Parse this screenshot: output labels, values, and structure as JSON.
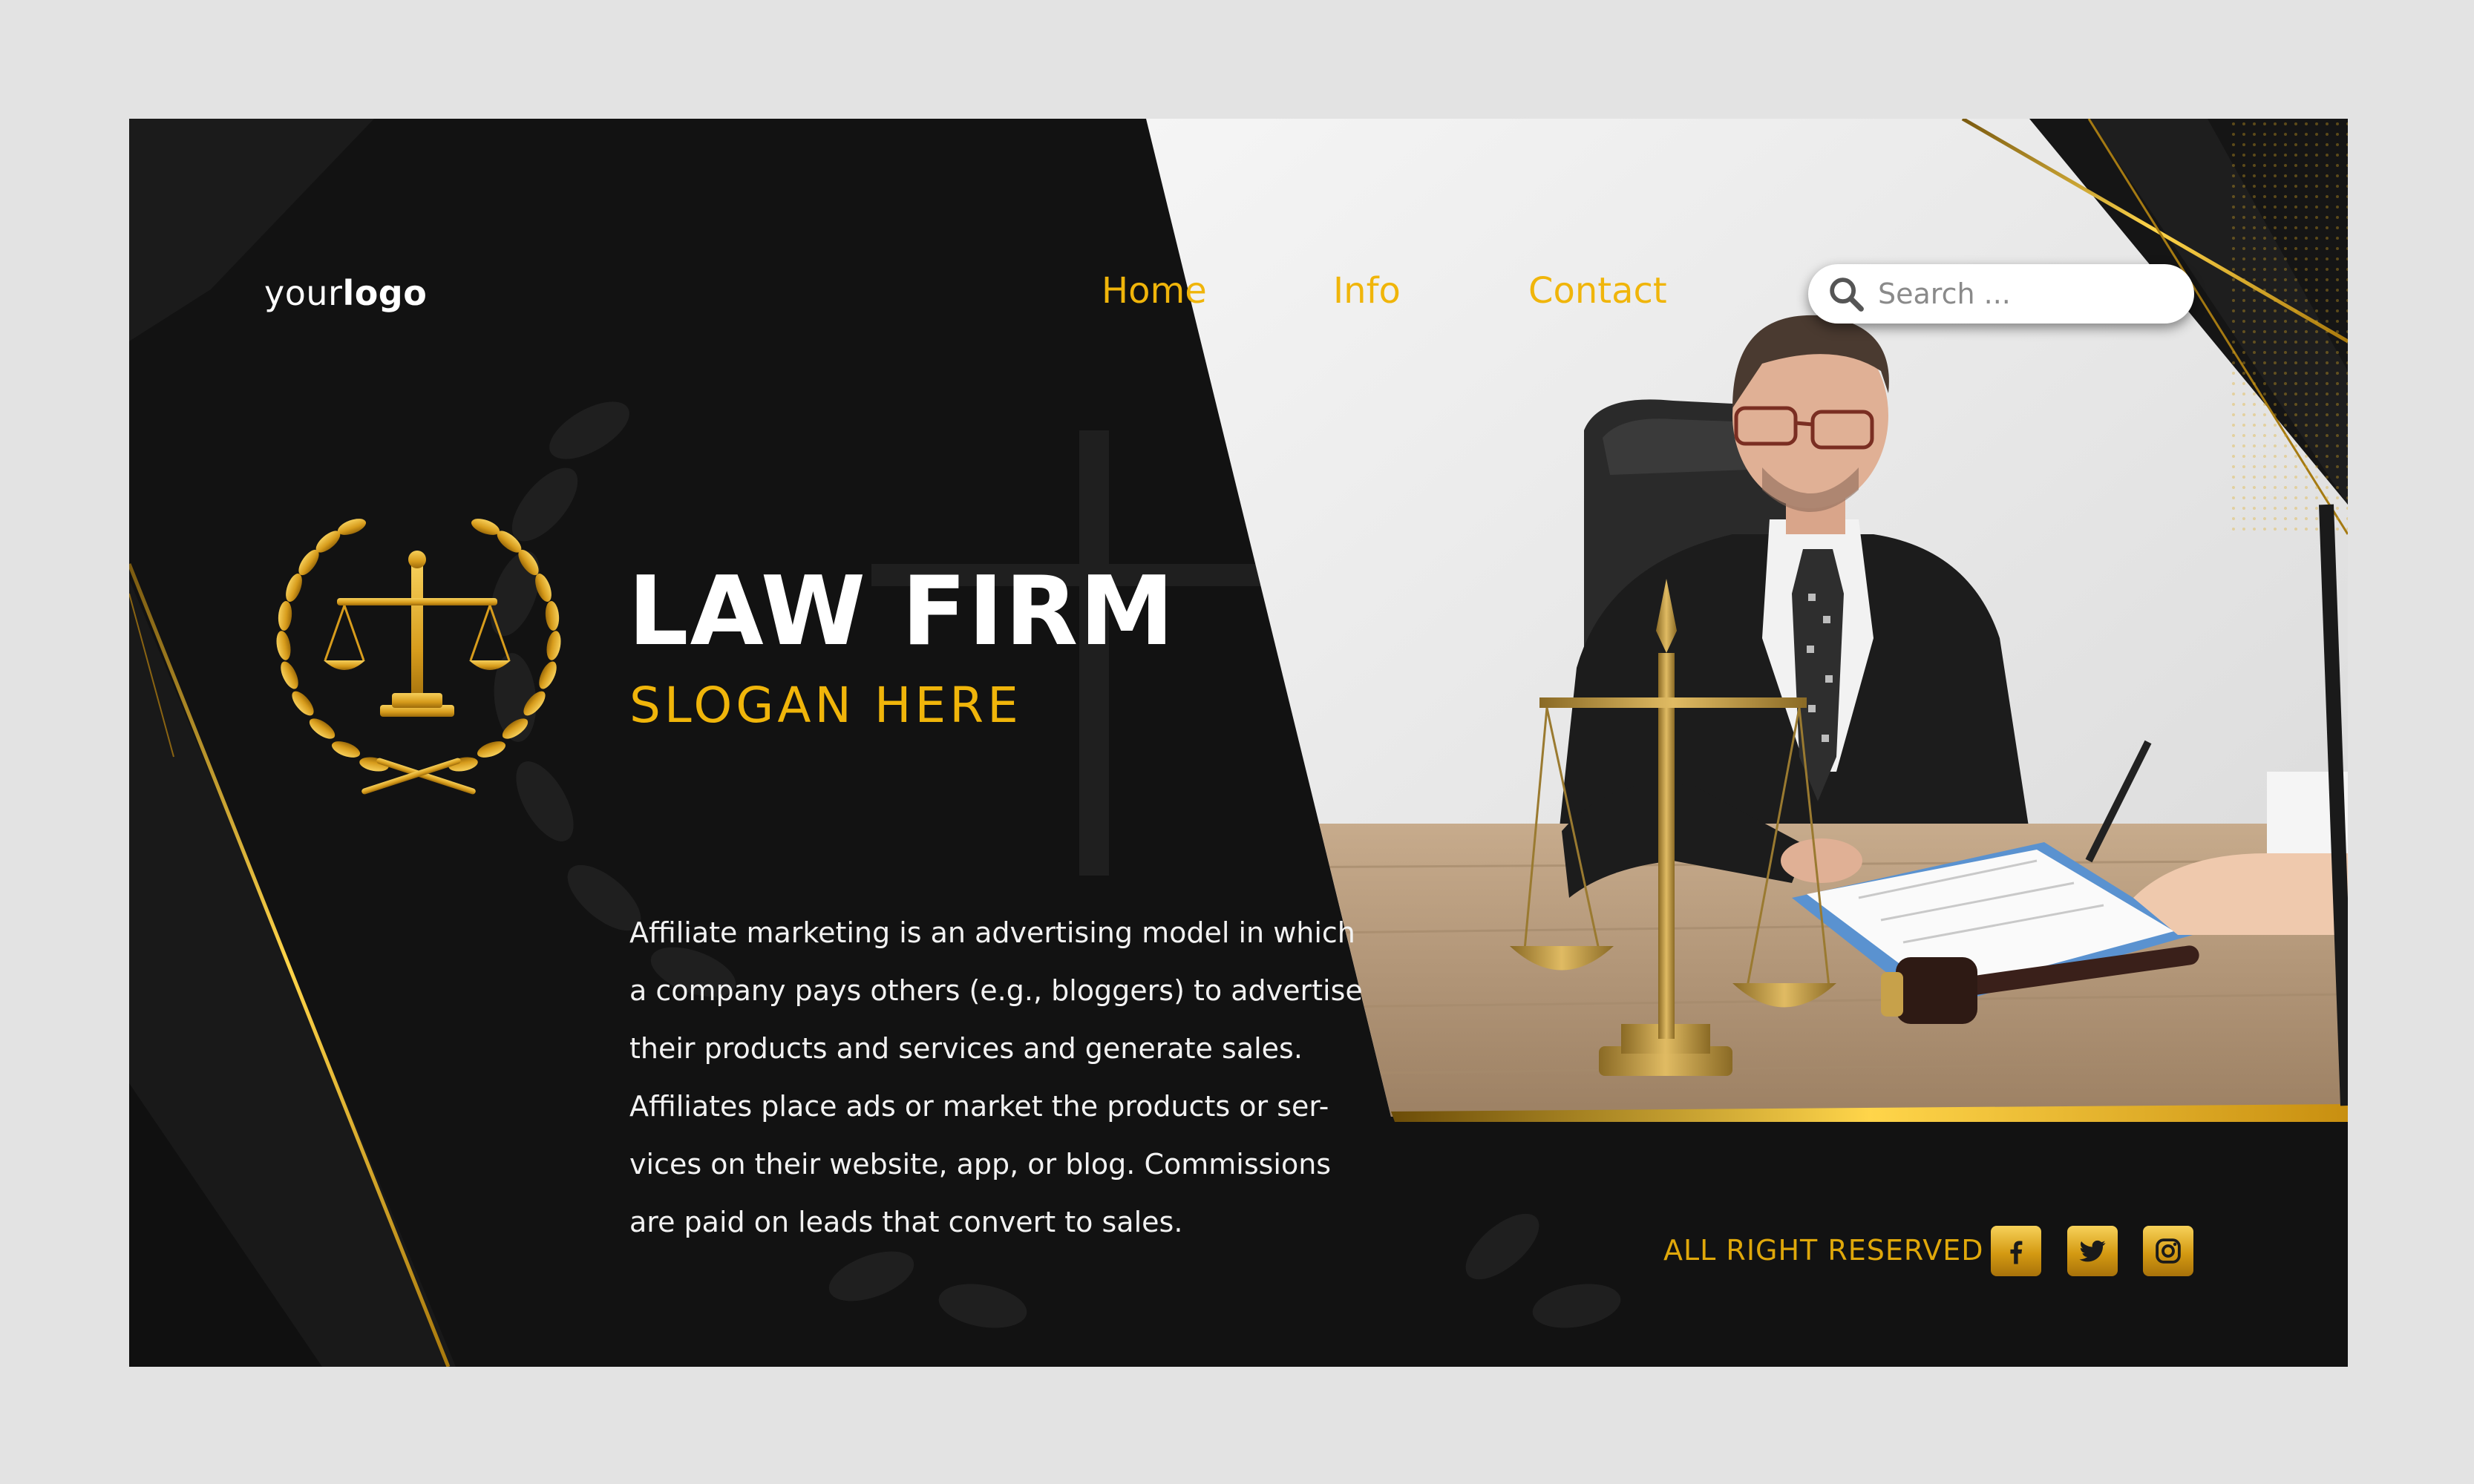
{
  "brand": {
    "logo_prefix": "your",
    "logo_bold": "logo"
  },
  "nav": {
    "items": [
      {
        "label": "Home"
      },
      {
        "label": "Info"
      },
      {
        "label": "Contact"
      }
    ]
  },
  "search": {
    "placeholder": "Search ..."
  },
  "hero": {
    "title": "LAW FIRM",
    "slogan": "SLOGAN HERE",
    "description_lines": [
      "Affiliate marketing is an advertising model in which",
      "a company pays others (e.g., bloggers) to advertise",
      "their products and services and generate sales.",
      "Affiliates place ads or market the products or ser-",
      "vices on their website, app, or blog. Commissions",
      "are paid on leads that convert to sales."
    ]
  },
  "footer": {
    "rights": "ALL RIGHT RESERVED",
    "social": [
      {
        "icon": "facebook-icon"
      },
      {
        "icon": "twitter-icon"
      },
      {
        "icon": "instagram-icon"
      }
    ]
  },
  "colors": {
    "accent_gold": "#f0b50a",
    "background": "#121212",
    "frame": "#e3e3e3"
  }
}
